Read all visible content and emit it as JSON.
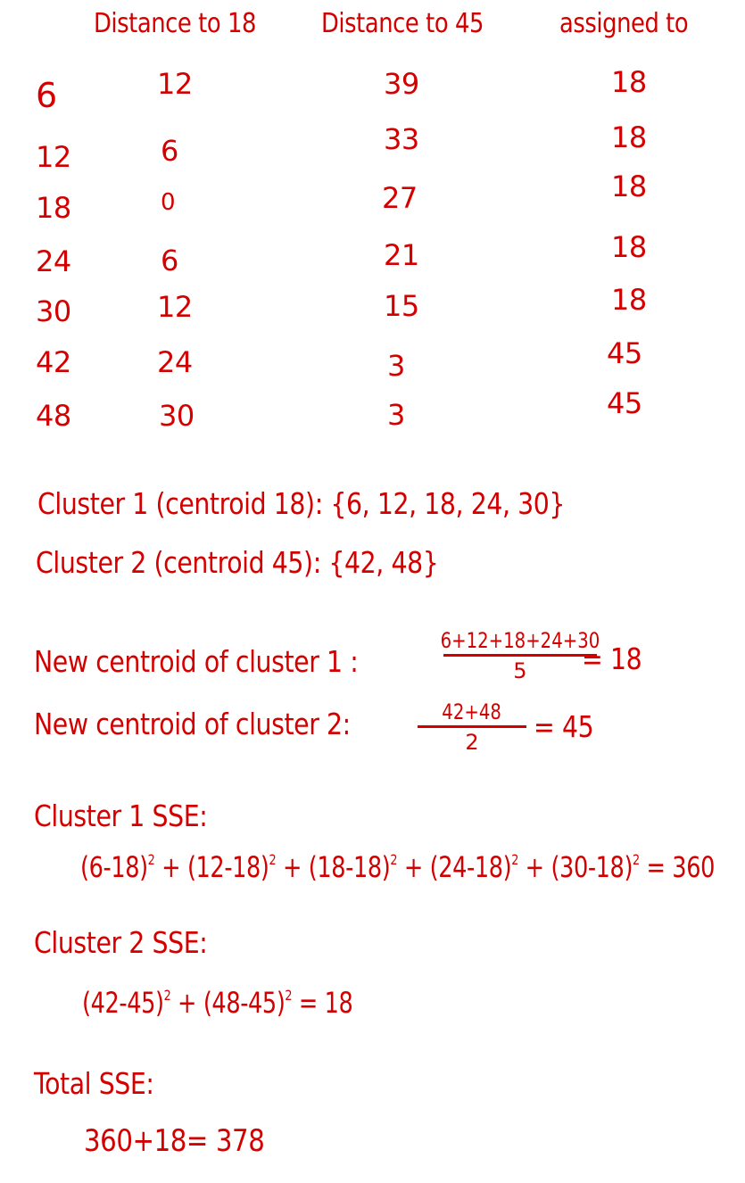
{
  "table": {
    "headers": {
      "distance_to_18": "Distance to 18",
      "distance_to_45": "Distance to 45",
      "assigned_to": "assigned to"
    },
    "rows": [
      {
        "point": "6",
        "d18": "12",
        "d45": "39",
        "assigned": "18"
      },
      {
        "point": "12",
        "d18": "6",
        "d45": "33",
        "assigned": "18"
      },
      {
        "point": "18",
        "d18": "0",
        "d45": "27",
        "assigned": "18"
      },
      {
        "point": "24",
        "d18": "6",
        "d45": "21",
        "assigned": "18"
      },
      {
        "point": "30",
        "d18": "12",
        "d45": "15",
        "assigned": "18"
      },
      {
        "point": "42",
        "d18": "24",
        "d45": "3",
        "assigned": "45"
      },
      {
        "point": "48",
        "d18": "30",
        "d45": "3",
        "assigned": "45"
      }
    ]
  },
  "clusters": {
    "cluster1": "Cluster 1 (centroid 18): {6, 12, 18, 24, 30}",
    "cluster2": "Cluster 2 (centroid 45): {42, 48}"
  },
  "new_centroids": {
    "c1_label": "New centroid of cluster 1 :",
    "c1_numerator": "6+12+18+24+30",
    "c1_denominator": "5",
    "c1_result": "= 18",
    "c2_label": "New centroid of cluster 2:",
    "c2_numerator": "42+48",
    "c2_denominator": "2",
    "c2_result": "= 45"
  },
  "sse": {
    "cluster1_label": "Cluster 1 SSE:",
    "cluster1_terms": [
      "(6-18)",
      "+ (12-18)",
      "+ (18-18)",
      "+ (24-18)",
      "+ (30-18)"
    ],
    "cluster1_exponent": "2",
    "cluster1_result": "= 360",
    "cluster2_label": "Cluster 2 SSE:",
    "cluster2_terms": [
      "(42-45)",
      "+ (48-45)"
    ],
    "cluster2_exponent": "2",
    "cluster2_result": "= 18",
    "total_label": "Total SSE:",
    "total_expression": "360+18= 378"
  },
  "colors": {
    "ink": "#d40000",
    "background": "#ffffff"
  }
}
